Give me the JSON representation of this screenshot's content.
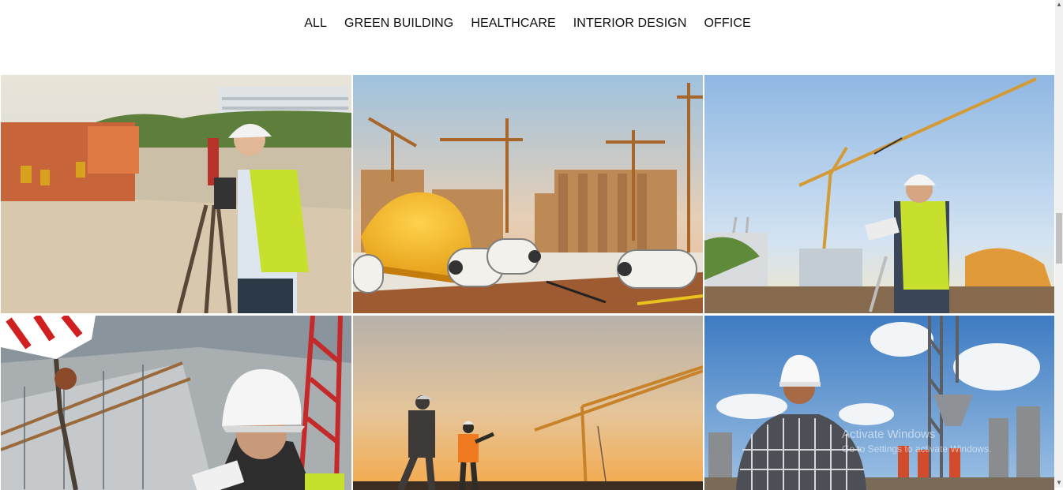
{
  "filters": [
    "ALL",
    "GREEN BUILDING",
    "HEALTHCARE",
    "INTERIOR DESIGN",
    "OFFICE"
  ],
  "gallery": [
    {
      "subject": "surveyor-with-theodolite"
    },
    {
      "subject": "hardhat-and-blueprints"
    },
    {
      "subject": "engineer-with-tablet-and-crane"
    },
    {
      "subject": "worker-overlooking-site"
    },
    {
      "subject": "workers-at-sunset-with-crane"
    },
    {
      "subject": "engineer-looking-at-tower-crane"
    }
  ],
  "watermark": {
    "title": "Activate Windows",
    "subtitle": "Go to Settings to activate Windows."
  },
  "colors": {
    "hardhat_yellow": "#f3b51c",
    "vest_yellow": "#c6e02d",
    "vest_orange": "#f06a1c",
    "crane_orange": "#d78a2a",
    "scrollbar_thumb": "#c1c1c1"
  }
}
